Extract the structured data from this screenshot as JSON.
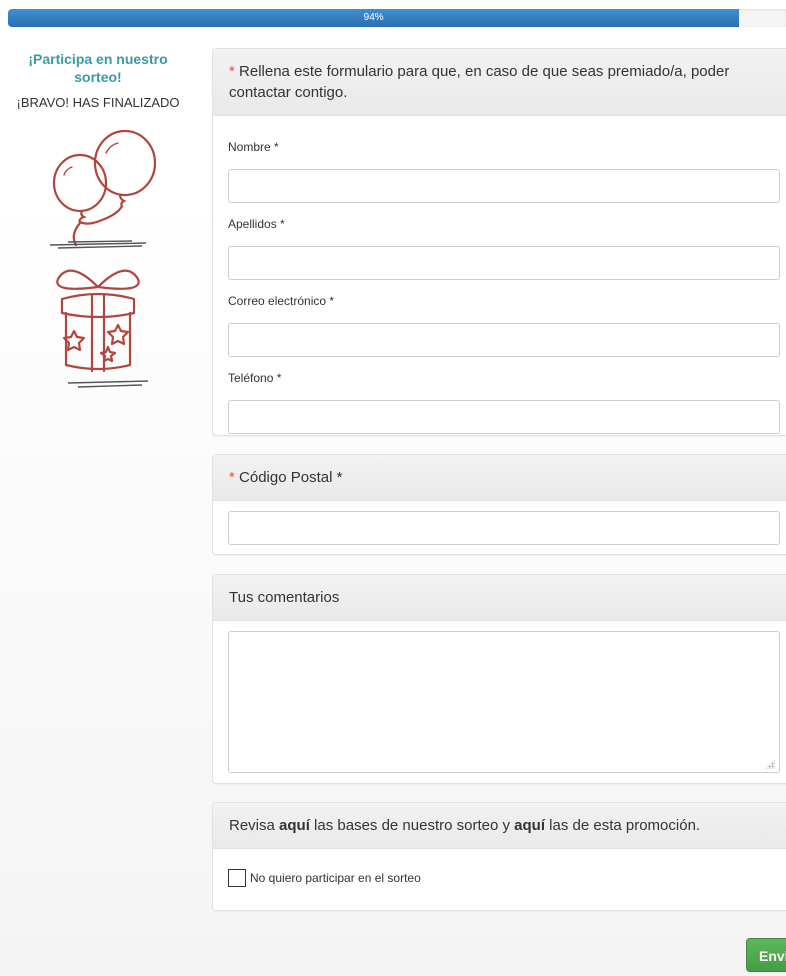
{
  "progress": {
    "label": "94%",
    "value": 94,
    "color": "#2f7fc4"
  },
  "sidebar": {
    "title": "¡Participa en nuestro sorteo!",
    "subtitle": "¡BRAVO! HAS FINALIZADO",
    "title_color": "#3a9aa4"
  },
  "contact_panel": {
    "required_mark": "*",
    "heading": "Rellena este formulario para que, en caso de que seas premiado/a, poder contactar contigo.",
    "fields": [
      {
        "label": "Nombre *",
        "value": ""
      },
      {
        "label": "Apellidos *",
        "value": ""
      },
      {
        "label": "Correo electrónico *",
        "value": ""
      },
      {
        "label": "Teléfono *",
        "value": ""
      }
    ]
  },
  "postal_panel": {
    "required_mark": "*",
    "heading": "Código Postal *",
    "value": ""
  },
  "comments_panel": {
    "heading": "Tus comentarios",
    "value": ""
  },
  "rules_panel": {
    "text_before": "Revisa ",
    "link1": "aquí",
    "text_middle": " las bases de nuestro sorteo y ",
    "link2": "aquí",
    "text_after": " las de esta promoción.",
    "checkbox_label": "No quiero participar en el sorteo",
    "checkbox_checked": false
  },
  "send_button": {
    "label": "Enviar",
    "color": "#5cb85c"
  },
  "icons": [
    "balloons-icon",
    "gift-icon",
    "resize-grip-icon"
  ]
}
